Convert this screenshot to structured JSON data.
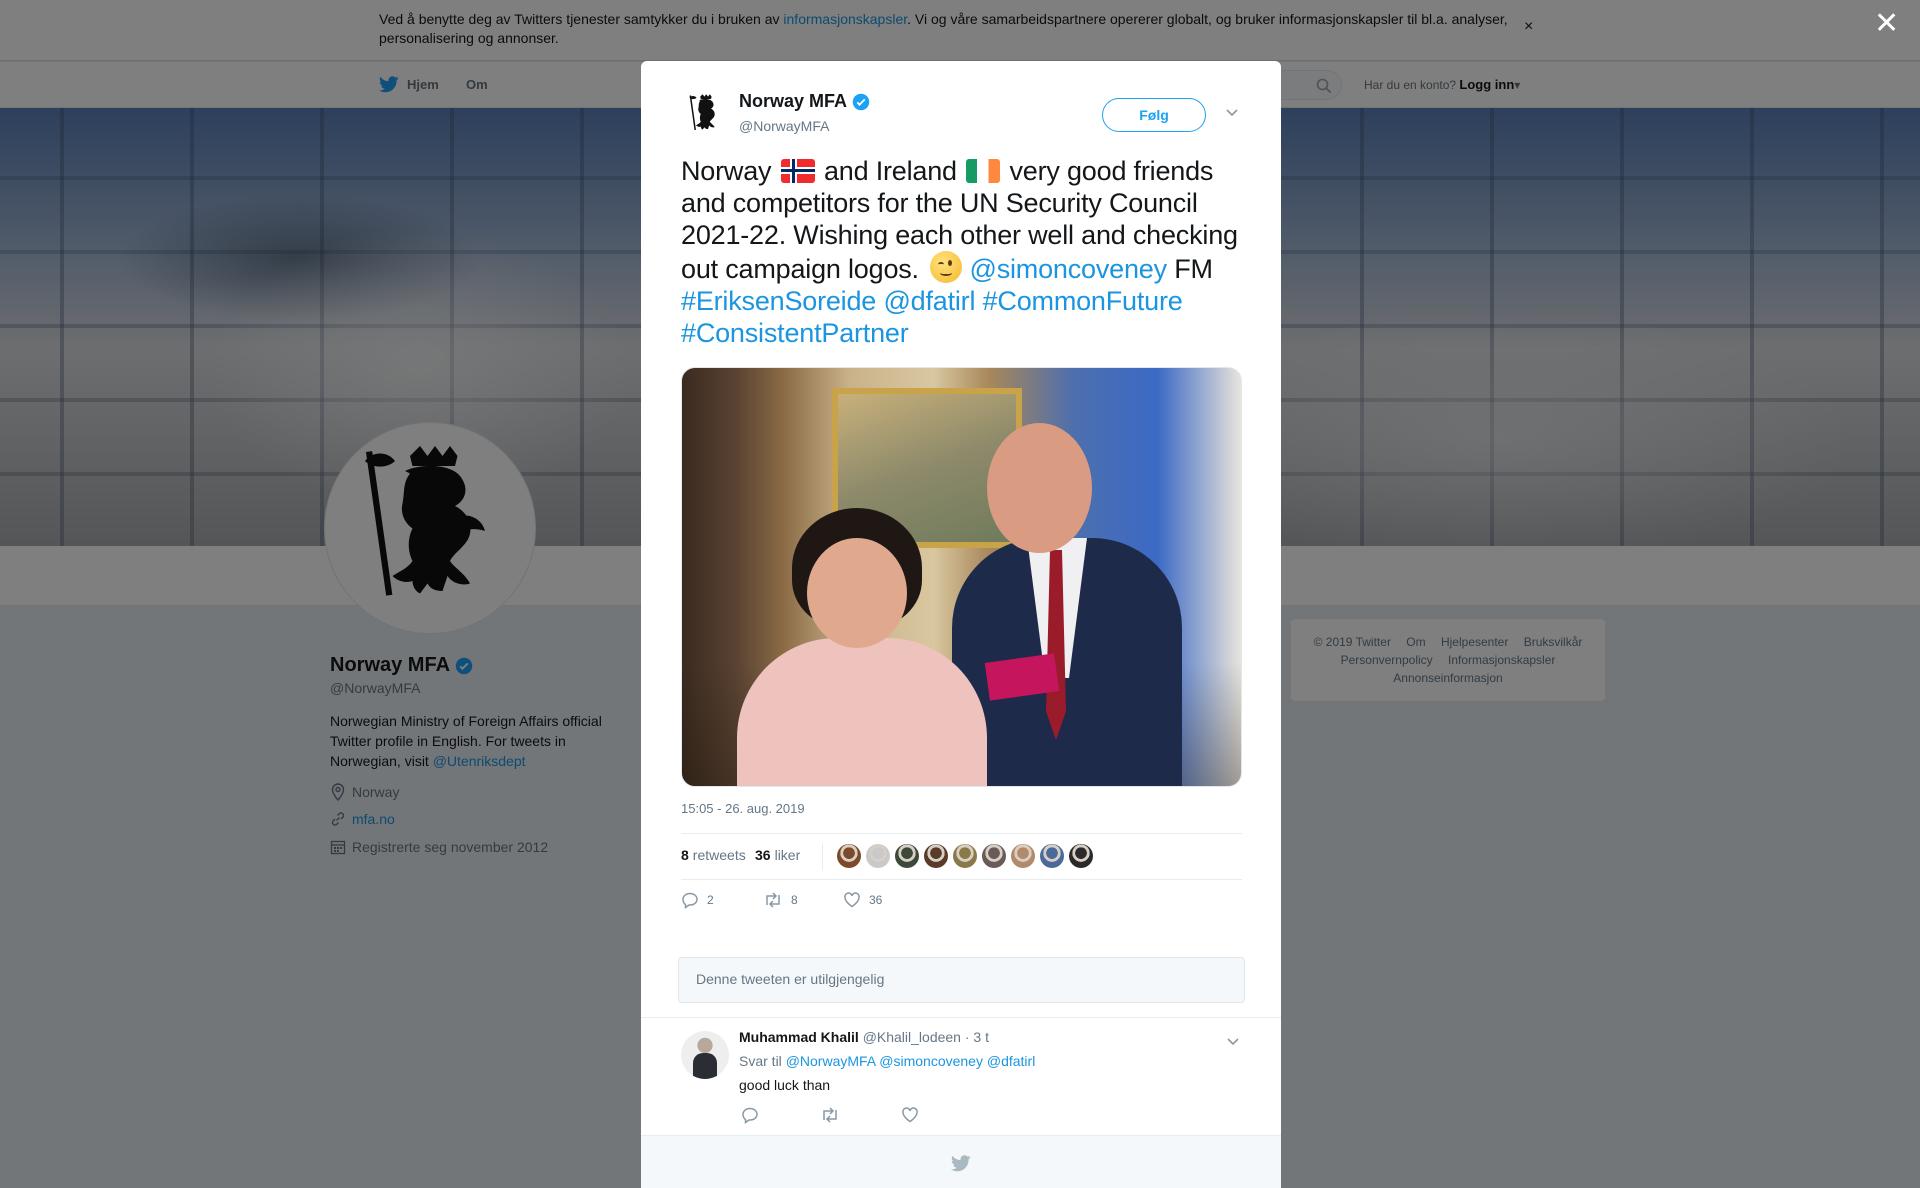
{
  "cookie": {
    "text_before": "Ved å benytte deg av Twitters tjenester samtykker du i bruken av ",
    "link": "informasjonskapsler",
    "text_after": ". Vi og våre samarbeidspartnere opererer globalt, og bruker informasjonskapsler til bl.a. analyser, personalisering og annonser.",
    "close": "×"
  },
  "nav": {
    "home": "Hjem",
    "about": "Om",
    "login_prompt": "Har du en konto?",
    "login": "Logg inn",
    "login_caret": "▾"
  },
  "overlay": {
    "close": "✕"
  },
  "profile": {
    "name": "Norway MFA",
    "handle": "@NorwayMFA",
    "bio_text": "Norwegian Ministry of Foreign Affairs official Twitter profile in English. For tweets in Norwegian, visit ",
    "bio_link": "@Utenriksdept",
    "location": "Norway",
    "website": "mfa.no",
    "joined": "Registrerte seg november 2012"
  },
  "footer": {
    "links": [
      "© 2019 Twitter",
      "Om",
      "Hjelpesenter",
      "Bruksvilkår",
      "Personvernpolicy",
      "Informasjonskapsler",
      "Annonseinformasjon"
    ]
  },
  "tweet": {
    "author_name": "Norway MFA",
    "author_handle": "@NorwayMFA",
    "follow_label": "Følg",
    "text_1": "Norway",
    "text_2": "and Ireland",
    "text_3": "very good friends and competitors for the UN Security Council 2021-22. Wishing each other well and checking out campaign logos.",
    "mention_1": "@simoncoveney",
    "text_fm": "FM",
    "hashtag_1": "#EriksenSoreide",
    "mention_2": "@dfatirl",
    "hashtag_2": "#CommonFuture",
    "hashtag_3": "#ConsistentPartner",
    "timestamp": "15:05 - 26. aug. 2019",
    "retweets_count": "8",
    "retweets_label": "retweets",
    "likes_count": "36",
    "likes_label": "liker",
    "reply_count": "2",
    "retweet_action_count": "8",
    "like_action_count": "36",
    "liker_colors": [
      "#7a4a2a",
      "#c9c9c9",
      "#3d4a3a",
      "#5a3a2a",
      "#8a7a4a",
      "#6a5a5a",
      "#b08a6a",
      "#4a6a9a",
      "#2a2a2a"
    ]
  },
  "reply_box": {
    "placeholder": "Denne tweeten er utilgjengelig"
  },
  "reply": {
    "name": "Muhammad Khalil",
    "handle": "@Khalil_lodeen",
    "time": "· 3 t",
    "reply_to_label": "Svar til",
    "to_1": "@NorwayMFA",
    "to_2": "@simoncoveney",
    "to_3": "@dfatirl",
    "text": "good luck than"
  },
  "colors": {
    "twitter_blue": "#1da1f2",
    "link_blue": "#1b95e0",
    "verified": "#1da1f2"
  }
}
